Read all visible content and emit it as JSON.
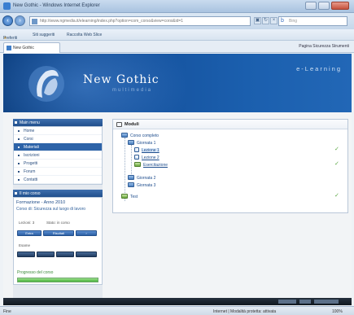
{
  "window": {
    "title": "New Gothic - Windows Internet Explorer"
  },
  "addressbar": {
    "url": "http://www.ngmedia.it/elearning/index.php?option=com_corso&view=corsi&id=1",
    "search_placeholder": "Bing"
  },
  "favorites": {
    "label": "Preferiti",
    "item1": "Siti suggeriti",
    "item2": "Raccolta Web Slice"
  },
  "tab": {
    "label": "New Gothic"
  },
  "commandbar": {
    "items": "Pagina  Sicurezza  Strumenti"
  },
  "banner": {
    "brand": "New Gothic",
    "subtitle": "multimedia",
    "tagline": "e-Learning"
  },
  "sidebar": {
    "menu_title": "Main menu",
    "items": [
      "Home",
      "Corsi",
      "Materiali",
      "Iscrizioni",
      "Progetti",
      "Forum",
      "Contatti"
    ],
    "selected_index": 2,
    "info_title": "Il mio corso",
    "course_name": "Formazione - Anno 2010",
    "course_desc": "Corso di: Sicurezza sul luogo di lavoro",
    "row1": "Lezioni: 3",
    "row2": "Stato: in corso",
    "btn_enter": "Entra",
    "btn_results": "Risultati",
    "row3": "Esame",
    "progress_label": "Progresso del corso",
    "progress": 1.0
  },
  "main": {
    "title": "Moduli",
    "tree": [
      {
        "label": "Corso completo"
      },
      {
        "label": "Giornata 1"
      },
      {
        "label": "Lezione 1"
      },
      {
        "label": "Lezione 2"
      },
      {
        "label": "Esercitazione"
      },
      {
        "label": "Giornata 2"
      },
      {
        "label": "Giornata 3"
      },
      {
        "label": "Test"
      }
    ]
  },
  "statusbar": {
    "left": "Fine",
    "zone": "Internet | Modalità protetta: attivata",
    "zoom": "100%"
  }
}
